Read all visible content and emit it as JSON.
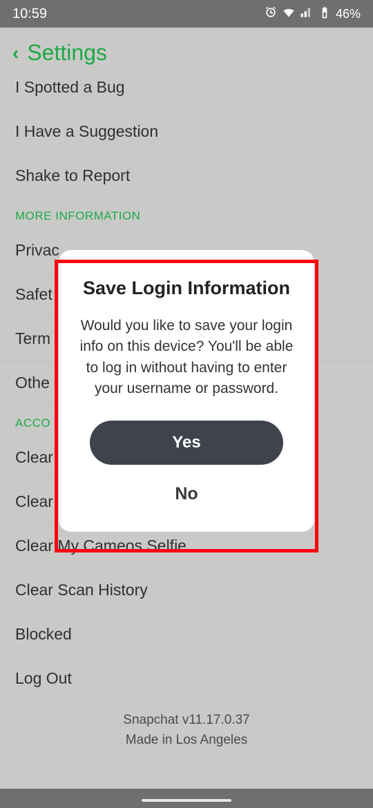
{
  "status": {
    "time": "10:59",
    "battery_text": "46%"
  },
  "header": {
    "title": "Settings"
  },
  "rows": {
    "bug": "I Spotted a Bug",
    "suggestion": "I Have a Suggestion",
    "shake": "Shake to Report",
    "privacy": "Privac",
    "safety": "Safet",
    "terms": "Term",
    "other": "Othe",
    "clear1": "Clear",
    "clear2": "Clear",
    "cameos": "Clear My Cameos Selfie",
    "scan": "Clear Scan History",
    "blocked": "Blocked",
    "logout": "Log Out"
  },
  "sections": {
    "more_info": "MORE INFORMATION",
    "account": "ACCO"
  },
  "footer": {
    "version": "Snapchat v11.17.0.37",
    "made": "Made in Los Angeles"
  },
  "dialog": {
    "title": "Save Login Information",
    "body": "Would you like to save your login info on this device? You'll be able to log in without having to enter your username or password.",
    "yes": "Yes",
    "no": "No"
  }
}
